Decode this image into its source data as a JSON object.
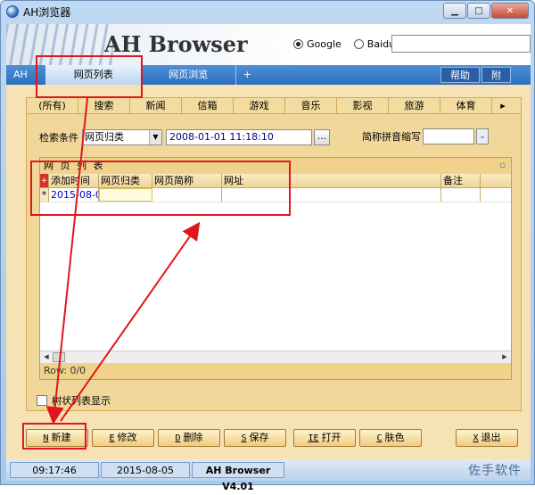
{
  "window": {
    "title": "AH浏览器",
    "minimize": "▁",
    "maximize": "□",
    "close": "✕"
  },
  "header": {
    "brand": "AH Browser",
    "engines": [
      {
        "label": "Google",
        "selected": true
      },
      {
        "label": "Baidu",
        "selected": false
      }
    ],
    "search_value": ""
  },
  "nav": {
    "tabs": [
      "AH",
      "网页列表",
      "网页浏览",
      "+"
    ],
    "help": "帮助",
    "attach": "附"
  },
  "categories": [
    "(所有)",
    "搜索",
    "新闻",
    "信箱",
    "游戏",
    "音乐",
    "影视",
    "旅游",
    "体育"
  ],
  "filter": {
    "label": "检索条件",
    "field": "网页归类",
    "datetime": "2008-01-01 11:18:10",
    "browse_btn": "...",
    "pinyin_label": "简称拼音缩写",
    "pinyin_value": ""
  },
  "grid": {
    "title": "网 页 列 表",
    "columns": [
      "添加时间",
      "网页归类",
      "网页简称",
      "网址",
      "备注"
    ],
    "rows": [
      {
        "marker": "*",
        "date": "2015-08-0",
        "category": "",
        "name": "",
        "url": "",
        "note": ""
      }
    ],
    "row_count": "Row: 0/0"
  },
  "tree_option": "树状列表显示",
  "buttons": [
    {
      "key": "N",
      "label": "新建"
    },
    {
      "key": "E",
      "label": "修改"
    },
    {
      "key": "D",
      "label": "删除"
    },
    {
      "key": "S",
      "label": "保存"
    },
    {
      "key": "IE",
      "label": "打开"
    },
    {
      "key": "C",
      "label": "肤色"
    },
    {
      "key": "X",
      "label": "退出"
    }
  ],
  "status": {
    "time": "09:17:46",
    "date": "2015-08-05",
    "version": "AH Browser V4.01",
    "watermark": "佐手软件"
  },
  "colors": {
    "annotation": "#e0161d",
    "nav_blue": "#2f6fbd",
    "panel": "#f1d89a"
  }
}
